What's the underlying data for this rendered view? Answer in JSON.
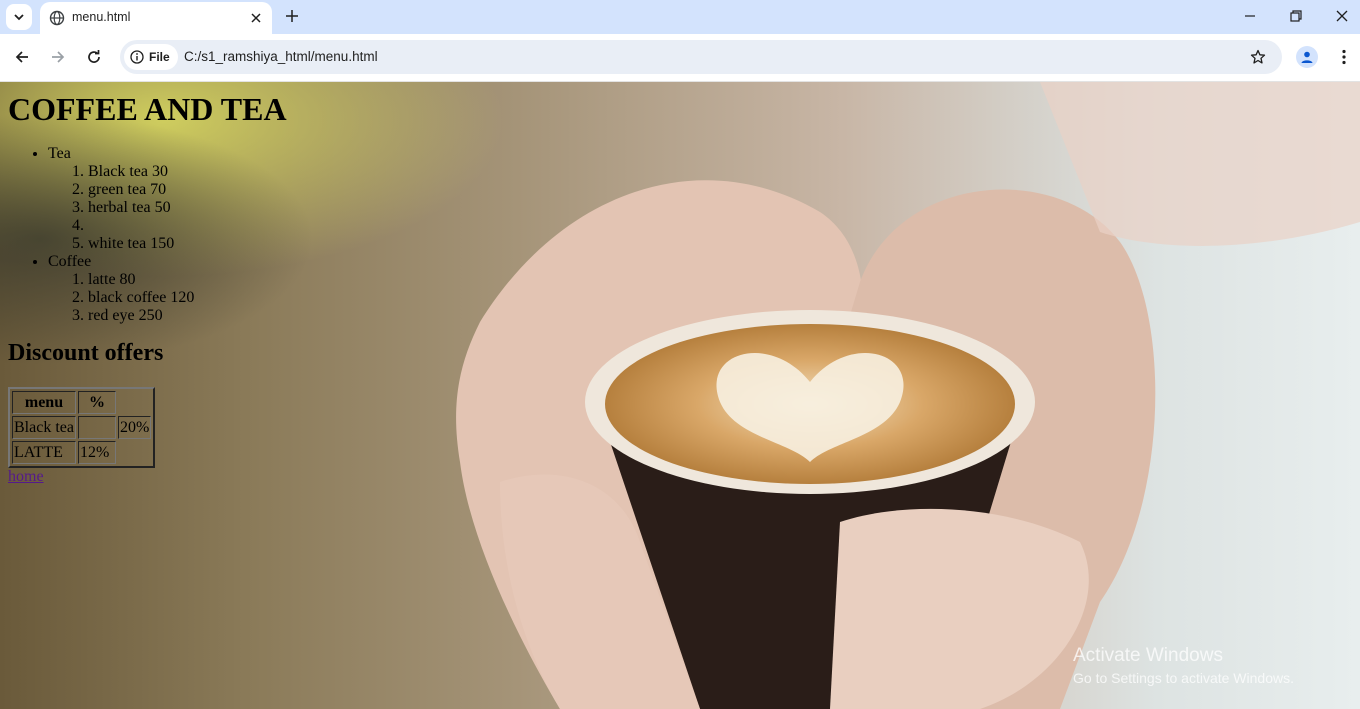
{
  "browser": {
    "tab_title": "menu.html",
    "scheme_label": "File",
    "url": "C:/s1_ramshiya_html/menu.html"
  },
  "page": {
    "heading": "COFFEE AND TEA",
    "categories": [
      {
        "name": "Tea",
        "items": [
          "Black tea 30",
          "green tea 70",
          "herbal tea 50",
          "",
          "white tea 150"
        ]
      },
      {
        "name": "Coffee",
        "items": [
          "latte 80",
          "black coffee 120",
          "red eye 250"
        ]
      }
    ],
    "discount_heading": "Discount offers",
    "table": {
      "headers": [
        "menu",
        "%"
      ],
      "rows": [
        [
          "Black tea",
          "",
          "20%"
        ],
        [
          "LATTE",
          "12%"
        ]
      ]
    },
    "home_link": "home"
  },
  "os_watermark": {
    "title": "Activate Windows",
    "subtitle": "Go to Settings to activate Windows."
  }
}
